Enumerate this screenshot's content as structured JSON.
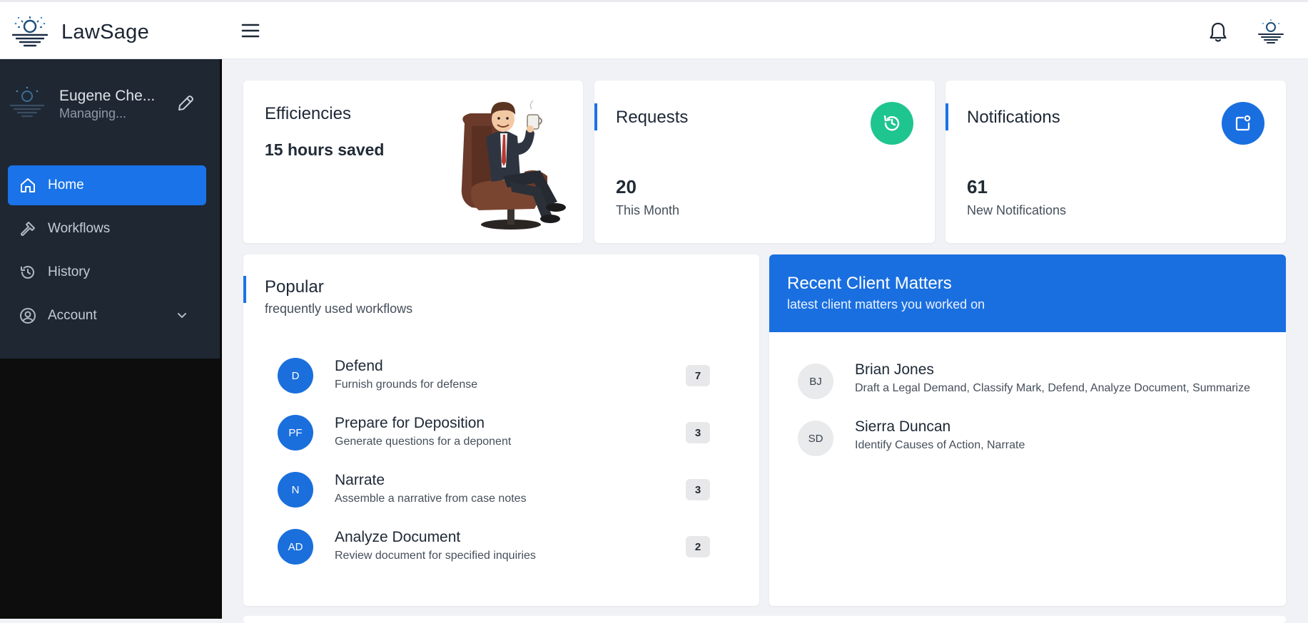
{
  "app": {
    "name": "LawSage"
  },
  "user": {
    "name": "Eugene Che...",
    "role": "Managing..."
  },
  "nav": {
    "items": [
      {
        "label": "Home",
        "icon": "home-icon",
        "active": true
      },
      {
        "label": "Workflows",
        "icon": "hammer-icon"
      },
      {
        "label": "History",
        "icon": "history-icon"
      },
      {
        "label": "Account",
        "icon": "user-circle-icon"
      }
    ]
  },
  "cards": {
    "efficiencies": {
      "title": "Efficiencies",
      "value": "15 hours saved"
    },
    "requests": {
      "title": "Requests",
      "count": "20",
      "sub": "This Month",
      "icon": "refresh-history-icon",
      "icon_color": "#1fc58e"
    },
    "notifications": {
      "title": "Notifications",
      "count": "61",
      "sub": "New Notifications",
      "icon": "notification-box-icon",
      "icon_color": "#1a6fe0"
    }
  },
  "popular": {
    "title": "Popular",
    "subtitle": "frequently used workflows",
    "items": [
      {
        "initials": "D",
        "name": "Defend",
        "desc": "Furnish grounds for defense",
        "count": "7"
      },
      {
        "initials": "PF",
        "name": "Prepare for Deposition",
        "desc": "Generate questions for a deponent",
        "count": "3"
      },
      {
        "initials": "N",
        "name": "Narrate",
        "desc": "Assemble a narrative from case notes",
        "count": "3"
      },
      {
        "initials": "AD",
        "name": "Analyze Document",
        "desc": "Review document for specified inquiries",
        "count": "2"
      }
    ]
  },
  "recent": {
    "title": "Recent Client Matters",
    "subtitle": "latest client matters you worked on",
    "items": [
      {
        "initials": "BJ",
        "name": "Brian Jones",
        "desc": "Draft a Legal Demand, Classify Mark, Defend, Analyze Document, Summarize"
      },
      {
        "initials": "SD",
        "name": "Sierra Duncan",
        "desc": "Identify Causes of Action, Narrate"
      }
    ]
  },
  "colors": {
    "accent": "#1a73e8",
    "sidebar": "#1f2733",
    "green": "#1fc58e"
  }
}
